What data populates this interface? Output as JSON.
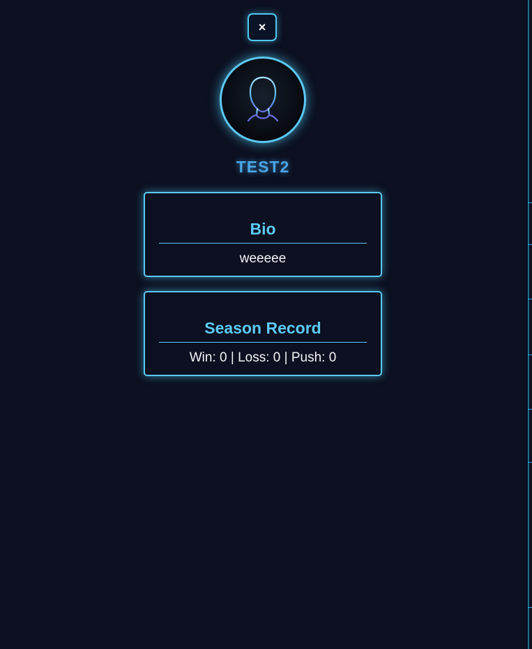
{
  "modal": {
    "close_label": "×"
  },
  "profile": {
    "avatar_icon": "user-silhouette-icon",
    "username": "TEST2"
  },
  "bio": {
    "title": "Bio",
    "text": "weeeee"
  },
  "season_record": {
    "title": "Season Record",
    "text": "Win: 0 | Loss: 0 | Push: 0"
  },
  "colors": {
    "background": "#0c1020",
    "accent": "#5cc9f5",
    "username": "#4aa6e6",
    "body_text": "#f2f4f8"
  }
}
